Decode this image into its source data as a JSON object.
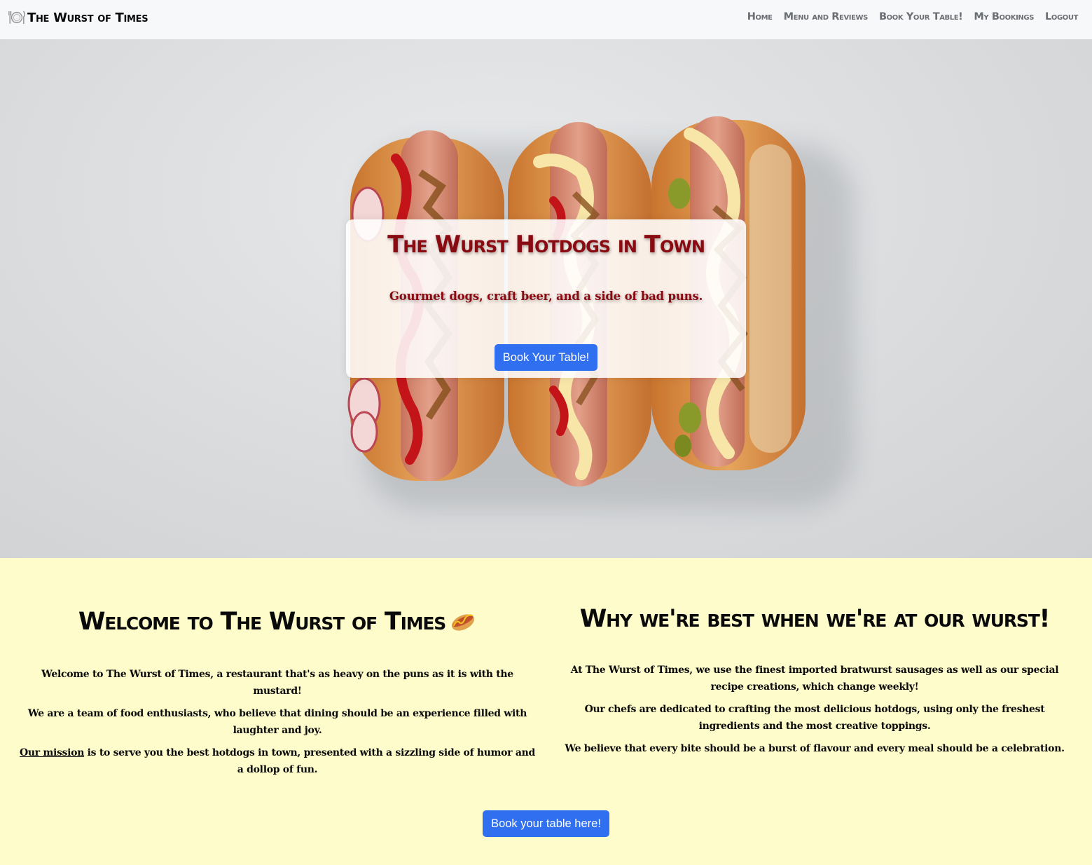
{
  "navbar": {
    "brand": "The Wurst of Times",
    "brand_icon": "plate-cutlery-icon",
    "links": [
      "Home",
      "Menu and Reviews",
      "Book Your Table!",
      "My Bookings",
      "Logout"
    ]
  },
  "hero": {
    "title": "The Wurst Hotdogs in Town",
    "subtitle": "Gourmet dogs, craft beer, and a side of bad puns.",
    "button": "Book Your Table!"
  },
  "about": {
    "welcome": {
      "heading": "Welcome to The Wurst of Times",
      "heading_icon": "hotdog-icon",
      "p1": "Welcome to The Wurst of Times, a restaurant that's as heavy on the puns as it is with the mustard!",
      "p2": "We are a team of food enthusiasts, who believe that dining should be an experience filled with laughter and joy.",
      "p3_link": "Our mission",
      "p3_rest": " is to serve you the best hotdogs in town, presented with a sizzling side of humor and a dollop of fun."
    },
    "why": {
      "heading": "Why we're best when we're at our wurst!",
      "p1": "At The Wurst of Times, we use the finest imported bratwurst sausages as well as our special recipe creations, which change weekly!",
      "p2": "Our chefs are dedicated to crafting the most delicious hotdogs, using only the freshest ingredients and the most creative toppings.",
      "p3": "We believe that every bite should be a burst of flavour and every meal should be a celebration."
    },
    "button": "Book your table here!"
  },
  "colors": {
    "navbar_bg": "#f7f8fa",
    "brand_red": "#8a0a12",
    "button_blue": "#2f6ff0",
    "about_bg": "#fffccb"
  }
}
